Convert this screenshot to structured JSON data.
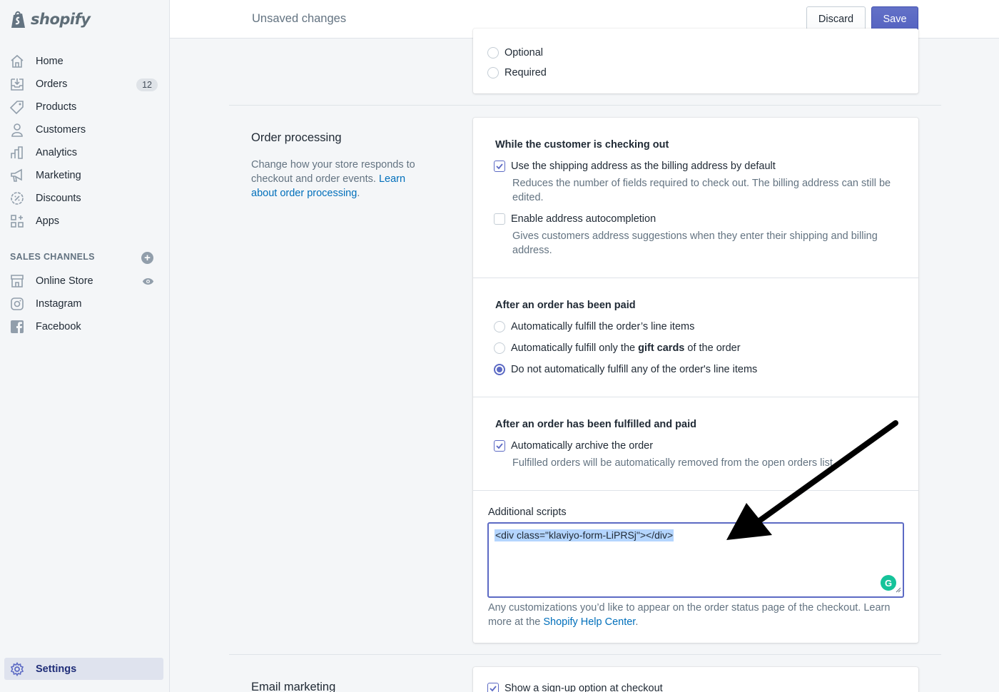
{
  "brand": {
    "name": "shopify"
  },
  "nav": {
    "items": [
      {
        "label": "Home",
        "icon": "home-icon"
      },
      {
        "label": "Orders",
        "icon": "orders-icon",
        "badge": "12"
      },
      {
        "label": "Products",
        "icon": "tag-icon"
      },
      {
        "label": "Customers",
        "icon": "person-icon"
      },
      {
        "label": "Analytics",
        "icon": "bar-chart-icon"
      },
      {
        "label": "Marketing",
        "icon": "megaphone-icon"
      },
      {
        "label": "Discounts",
        "icon": "discount-icon"
      },
      {
        "label": "Apps",
        "icon": "apps-icon"
      }
    ],
    "sales_channels_title": "SALES CHANNELS",
    "channels": [
      {
        "label": "Online Store",
        "icon": "store-icon"
      },
      {
        "label": "Instagram",
        "icon": "instagram-icon"
      },
      {
        "label": "Facebook",
        "icon": "facebook-icon"
      }
    ],
    "settings_label": "Settings"
  },
  "topbar": {
    "title": "Unsaved changes",
    "discard_label": "Discard",
    "save_label": "Save"
  },
  "top_card": {
    "options": [
      "Optional",
      "Required"
    ]
  },
  "order_processing": {
    "title": "Order processing",
    "description_prefix": "Change how your store responds to checkout and order events. ",
    "description_link": "Learn about order processing",
    "description_suffix": ".",
    "checkout": {
      "heading": "While the customer is checking out",
      "option1_label": "Use the shipping address as the billing address by default",
      "option1_checked": true,
      "option1_help": "Reduces the number of fields required to check out. The billing address can still be edited.",
      "option2_label": "Enable address autocompletion",
      "option2_checked": false,
      "option2_help": "Gives customers address suggestions when they enter their shipping and billing address."
    },
    "paid": {
      "heading": "After an order has been paid",
      "radio1": "Automatically fulfill the order’s line items",
      "radio2_prefix": "Automatically fulfill only the ",
      "radio2_bold": "gift cards",
      "radio2_suffix": " of the order",
      "radio3": "Do not automatically fulfill any of the order's line items",
      "selected": 3
    },
    "fulfilled": {
      "heading": "After an order has been fulfilled and paid",
      "option_label": "Automatically archive the order",
      "option_checked": true,
      "option_help": "Fulfilled orders will be automatically removed from the open orders list."
    },
    "scripts": {
      "label": "Additional scripts",
      "value": "<div class=\"klaviyo-form-LiPRSj\"></div>",
      "help_prefix": "Any customizations you’d like to appear on the order status page of the checkout. Learn more at the ",
      "help_link": "Shopify Help Center",
      "help_suffix": "."
    }
  },
  "email_marketing": {
    "title": "Email marketing",
    "option_label": "Show a sign-up option at checkout",
    "option_checked": true
  },
  "colors": {
    "accent": "#5c6ac4",
    "link": "#006fbb",
    "selection": "#b4d5fe",
    "grammarly": "#15c39a"
  }
}
